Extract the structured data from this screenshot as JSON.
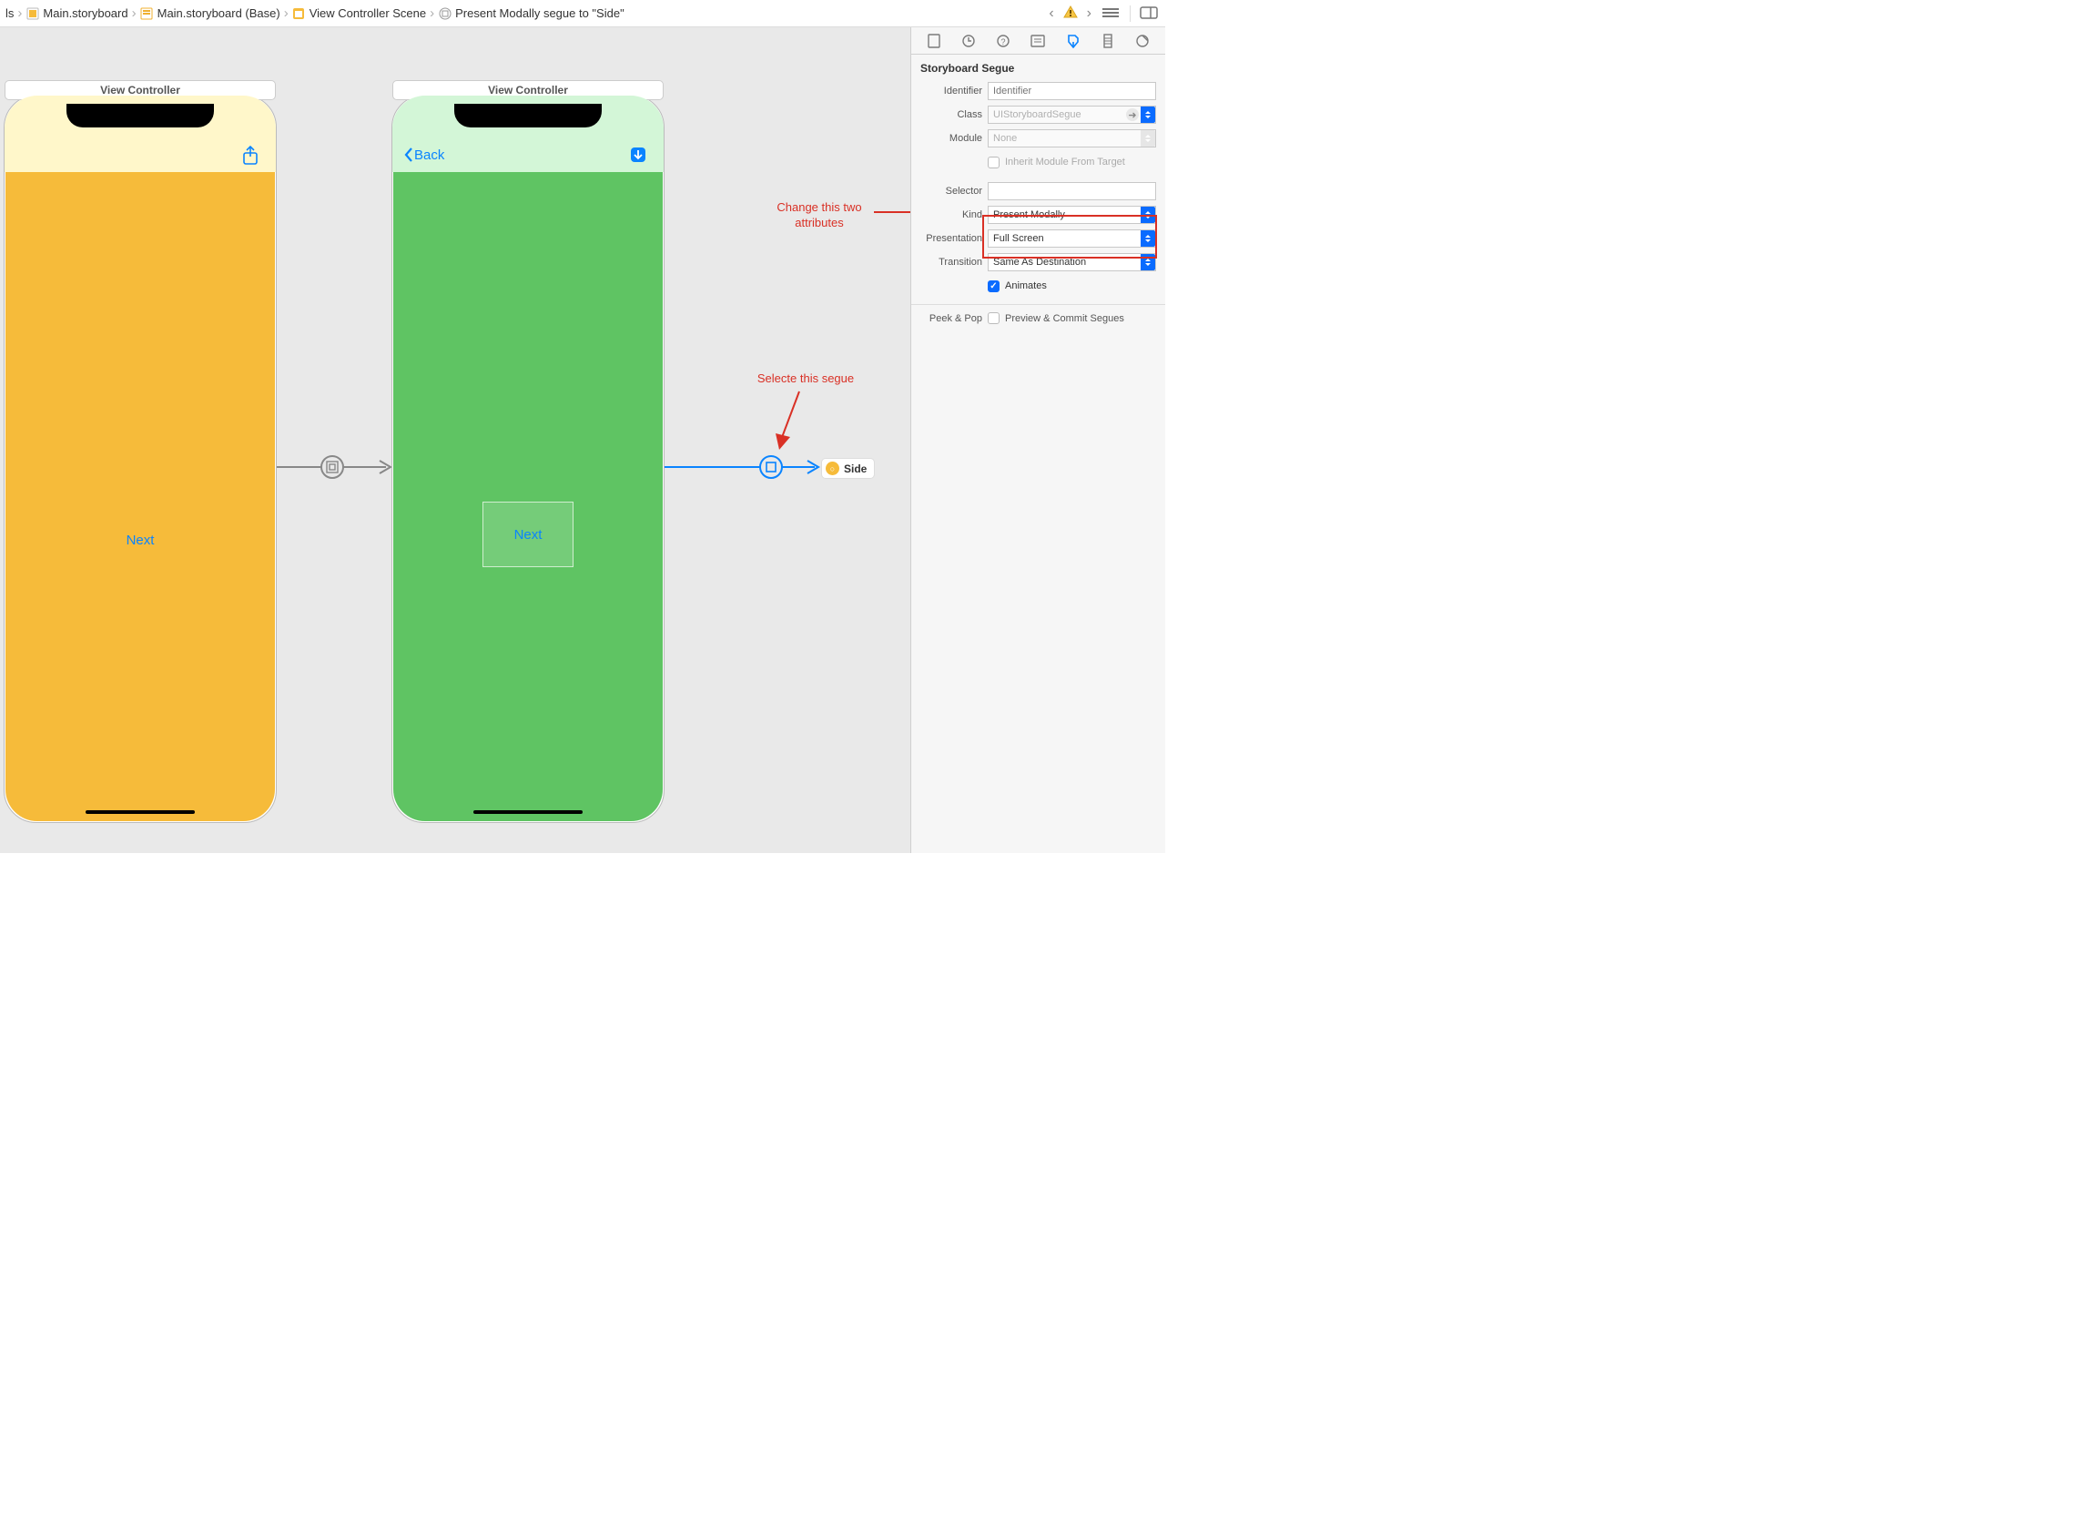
{
  "breadcrumb": {
    "item0": "ls",
    "item1": "Main.storyboard",
    "item2": "Main.storyboard (Base)",
    "item3": "View Controller Scene",
    "item4": "Present Modally segue to \"Side\""
  },
  "canvas": {
    "phone1_title": "View Controller",
    "phone1_button": "Next",
    "phone2_title": "View Controller",
    "phone2_back": "Back",
    "phone2_button": "Next",
    "side_label": "Side"
  },
  "annotations": {
    "change_line1": "Change this two",
    "change_line2": "attributes",
    "select": "Selecte this segue"
  },
  "inspector": {
    "header": "Storyboard Segue",
    "labels": {
      "identifier": "Identifier",
      "class": "Class",
      "module": "Module",
      "inherit": "Inherit Module From Target",
      "selector": "Selector",
      "kind": "Kind",
      "presentation": "Presentation",
      "transition": "Transition",
      "animates": "Animates",
      "peek": "Peek & Pop",
      "preview": "Preview & Commit Segues"
    },
    "values": {
      "identifier_placeholder": "Identifier",
      "class_placeholder": "UIStoryboardSegue",
      "module_placeholder": "None",
      "selector_value": "",
      "kind": "Present Modally",
      "presentation": "Full Screen",
      "transition": "Same As Destination"
    }
  }
}
